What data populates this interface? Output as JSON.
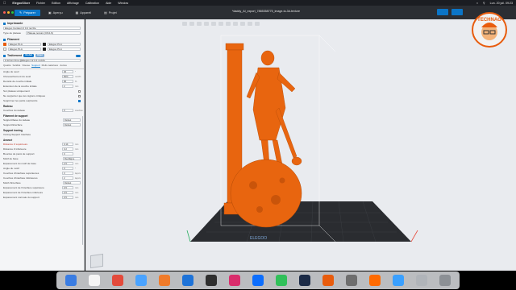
{
  "menubar": {
    "app_name": "ElegooSlicer",
    "items": [
      "Fichier",
      "Edition",
      "Affichage",
      "Calibration",
      "Aide",
      "Window"
    ],
    "clock": "Lun. 20 juil. 09:23"
  },
  "titlebar": {
    "tabs": [
      {
        "label": "Préparer",
        "active": true
      },
      {
        "label": "Aperçu",
        "active": false
      },
      {
        "label": "Appareil",
        "active": false
      },
      {
        "label": "Projet",
        "active": false
      }
    ],
    "document_title": "*daddy_AI_export_7865358775_image-to-3d-texture"
  },
  "panel": {
    "printer_section": "Imprimante",
    "printer_value": "Elegoo Centauri 2 0.4 nozzle",
    "bed_label": "Type de plateau",
    "bed_value": "Plateau texturé (CN4-S)",
    "filament_section": "Filament",
    "filaments": [
      {
        "left": "Elegoo PLA",
        "right": "Elegoo PLA",
        "color_left": "#e85c0d",
        "color_right": "#222222"
      },
      {
        "left": "Elegoo PLA",
        "right": "Elegoo PLA",
        "color_left": "#f2f2f2",
        "color_right": "#222222"
      }
    ],
    "process_section": "Traitement",
    "process_pills": [
      "Global",
      "Objet"
    ],
    "process_value": "0.12mm Fine @Elegoo C2 0.4 nozzle",
    "tabs": [
      "Qualité",
      "Solidité",
      "Vitesse",
      "Support",
      "Multi-matériaux",
      "Autres"
    ],
    "active_tab": "Support",
    "fields": [
      {
        "label": "Angle de seuil",
        "value": "30",
        "unit": "°"
      },
      {
        "label": "Chevauchement du seuil",
        "value": "50%",
        "unit": "mm/%"
      },
      {
        "label": "Densité de couche initiale",
        "value": "90",
        "unit": "%"
      },
      {
        "label": "Extension de la couche initiale",
        "value": "2",
        "unit": "mm"
      },
      {
        "label": "Sur plateau uniquement",
        "value": "",
        "unit": ""
      },
      {
        "label": "Ne supporter que les régions critiques",
        "value": "",
        "unit": ""
      },
      {
        "label": "Supprimer les petits surplombs",
        "value": "",
        "unit": ""
      }
    ],
    "raft_head": "Radeau",
    "raft_fields": [
      {
        "label": "Couches du radeau",
        "value": "0",
        "unit": "couches"
      }
    ],
    "support_filament_head": "Filament de support",
    "support_filament_fields": [
      {
        "label": "Support/base du radeau",
        "value": "Défaut"
      },
      {
        "label": "Support/interface",
        "value": "Défaut"
      }
    ],
    "ironing_head": "Support ironing",
    "ironing_label": "Ironing Support Interface",
    "advanced_head": "Avancé",
    "advanced_fields": [
      {
        "label": "Distance Z supérieure",
        "value": "0.14",
        "unit": "mm"
      },
      {
        "label": "Distance Z inférieure",
        "value": "0.2",
        "unit": "mm"
      },
      {
        "label": "Boucles de paroi de support",
        "value": "0",
        "unit": ""
      },
      {
        "label": "Motif de base",
        "value": "Rectiligne",
        "unit": ""
      },
      {
        "label": "Espacement du motif de base",
        "value": "2.5",
        "unit": "mm"
      },
      {
        "label": "Angle du motif",
        "value": "0",
        "unit": "°"
      },
      {
        "label": "Couches d'interface supérieures",
        "value": "3",
        "unit": "layers"
      },
      {
        "label": "Couches d'interface inférieures",
        "value": "2",
        "unit": "layers"
      },
      {
        "label": "Motif d'interface",
        "value": "Défaut",
        "unit": ""
      },
      {
        "label": "Espacement de l'interface supérieure",
        "value": "0.5",
        "unit": "mm"
      },
      {
        "label": "Espacement de l'interface inférieure",
        "value": "0.5",
        "unit": "mm"
      },
      {
        "label": "Espacement normale du support",
        "value": "0.5",
        "unit": "mm"
      }
    ]
  },
  "viewport": {
    "bed_brand": "ELEGOO",
    "model_color": "#e8650f"
  },
  "logo": {
    "text": "TECHNAG"
  }
}
